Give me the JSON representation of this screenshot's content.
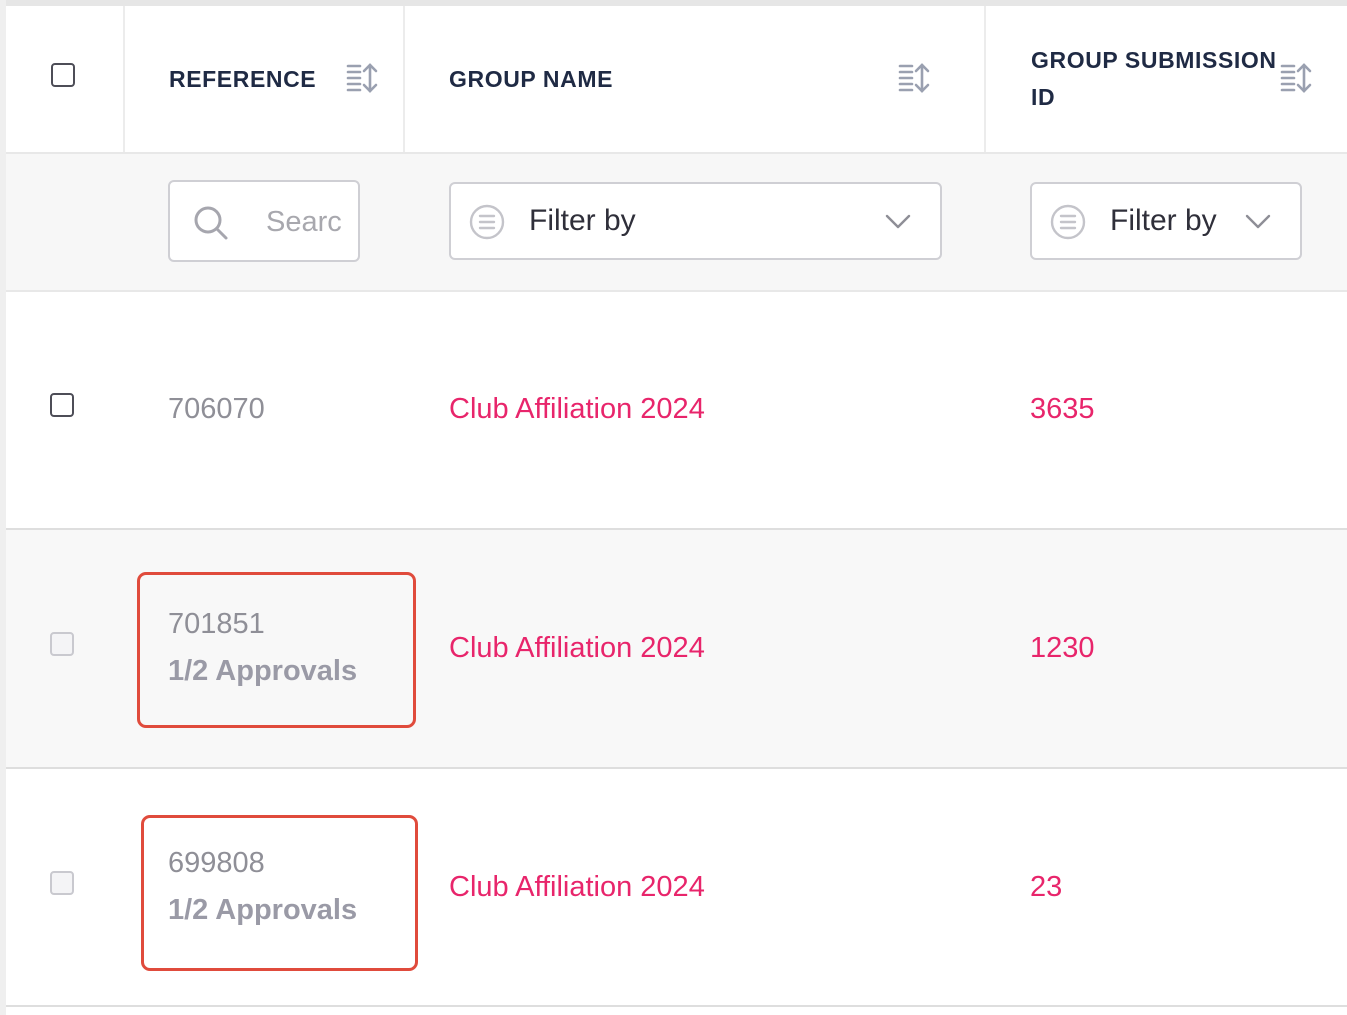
{
  "table": {
    "columns": [
      {
        "title_line1": "REFERENCE",
        "title_line2": ""
      },
      {
        "title_line1": "GROUP NAME",
        "title_line2": ""
      },
      {
        "title_line1": "GROUP SUBMISSION",
        "title_line2": "ID"
      }
    ],
    "filters": {
      "search_placeholder": "Search",
      "group_name_filter_label": "Filter by",
      "group_submission_filter_label": "Filter by"
    },
    "rows": [
      {
        "reference": "706070",
        "approvals": "",
        "group_name": "Club Affiliation 2024",
        "group_submission_id": "3635",
        "highlighted": false
      },
      {
        "reference": "701851",
        "approvals": "1/2 Approvals",
        "group_name": "Club Affiliation 2024",
        "group_submission_id": "1230",
        "highlighted": true
      },
      {
        "reference": "699808",
        "approvals": "1/2 Approvals",
        "group_name": "Club Affiliation 2024",
        "group_submission_id": "23",
        "highlighted": true
      }
    ]
  },
  "colors": {
    "accent_link": "#e8256b",
    "header_text": "#1f2a44",
    "highlight_border": "#e04b3c"
  },
  "icons": [
    "sort-icon",
    "search-icon",
    "filter-icon",
    "chevron-down-icon"
  ]
}
